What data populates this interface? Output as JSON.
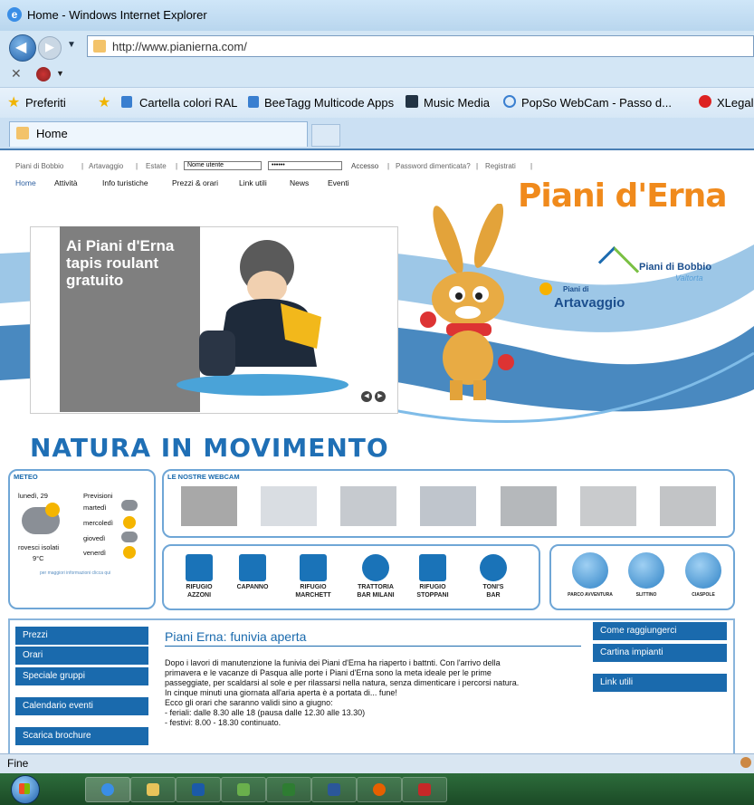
{
  "browser": {
    "window_title": "Home - Windows Internet Explorer",
    "url": "http://www.pianierna.com/",
    "favorites_label": "Preferiti",
    "favorites": [
      "Cartella colori RAL",
      "BeeTagg Multicode Apps",
      "Music Media",
      "PopSo WebCam - Passo d...",
      "XLegalmai"
    ],
    "tab_title": "Home",
    "status": "Fine"
  },
  "site": {
    "top_links": [
      "Piani di Bobbio",
      "Artavaggio",
      "Estate"
    ],
    "username_placeholder": "Nome utente",
    "password_value": "••••••",
    "login_label": "Accesso",
    "forgot_password": "Password dimenticata?",
    "register": "Registrati",
    "menu": [
      "Home",
      "Attività",
      "Info turistiche",
      "Prezzi & orari",
      "Link utili",
      "News",
      "Eventi"
    ],
    "title": "Piani d'Erna",
    "logo_bobbio": "Piani di Bobbio",
    "logo_bobbio_sub": "Valtorta",
    "logo_artavaggio_small": "Piani di",
    "logo_artavaggio": "Artavaggio",
    "banner_text": "Ai Piani d'Erna tapis roulant gratuito",
    "slogan": "NATURA IN MOVIMENTO"
  },
  "meteo": {
    "title": "METEO",
    "today": "lunedì, 29",
    "forecast_label": "Previsioni",
    "days": [
      "martedì",
      "mercoledì",
      "giovedì",
      "venerdì"
    ],
    "condition": "rovesci isolati",
    "temp": "9°C",
    "more": "per maggiori informazioni clicca qui"
  },
  "webcam": {
    "title": "LE NOSTRE WEBCAM"
  },
  "rifugi": [
    {
      "line1": "RIFUGIO",
      "line2": "AZZONI"
    },
    {
      "line1": "CAPANNO",
      "line2": ""
    },
    {
      "line1": "RIFUGIO",
      "line2": "MARCHETT"
    },
    {
      "line1": "TRATTORIA",
      "line2": "BAR MILANI"
    },
    {
      "line1": "RIFUGIO",
      "line2": "STOPPANI"
    },
    {
      "line1": "TONI'S",
      "line2": "BAR"
    }
  ],
  "activities": [
    "PARCO AVVENTURA",
    "SLITTINO",
    "CIASPOLE"
  ],
  "sidebar": [
    "Prezzi",
    "Orari",
    "Speciale gruppi",
    "Calendario eventi",
    "Scarica brochure"
  ],
  "rightbar": [
    "Come raggiungerci",
    "Cartina impianti",
    "Link utili"
  ],
  "news": {
    "title": "Piani Erna: funivia aperta",
    "lines": [
      "Dopo i lavori di manutenzione la funivia dei Piani d'Erna ha riaperto i battnti. Con l'arrivo della",
      "primavera e le vacanze di Pasqua alle porte i Piani d'Erna sono la meta ideale per le prime",
      "passeggiate, per scaldarsi al sole e per rilassarsi nella natura, senza dimenticare i percorsi natura.",
      "In cinque minuti una giornata all'aria aperta è a portata di... fune!",
      "Ecco gli orari che saranno validi sino a giugno:",
      "- feriali: dalle 8.30 alle 18 (pausa dalle 12.30 alle 13.30)",
      "- festivi: 8.00 - 18.30 continuato."
    ]
  },
  "colors": {
    "brand_orange": "#f08a1c",
    "brand_blue": "#1a6aad",
    "chrome": "#d3e6f5"
  }
}
